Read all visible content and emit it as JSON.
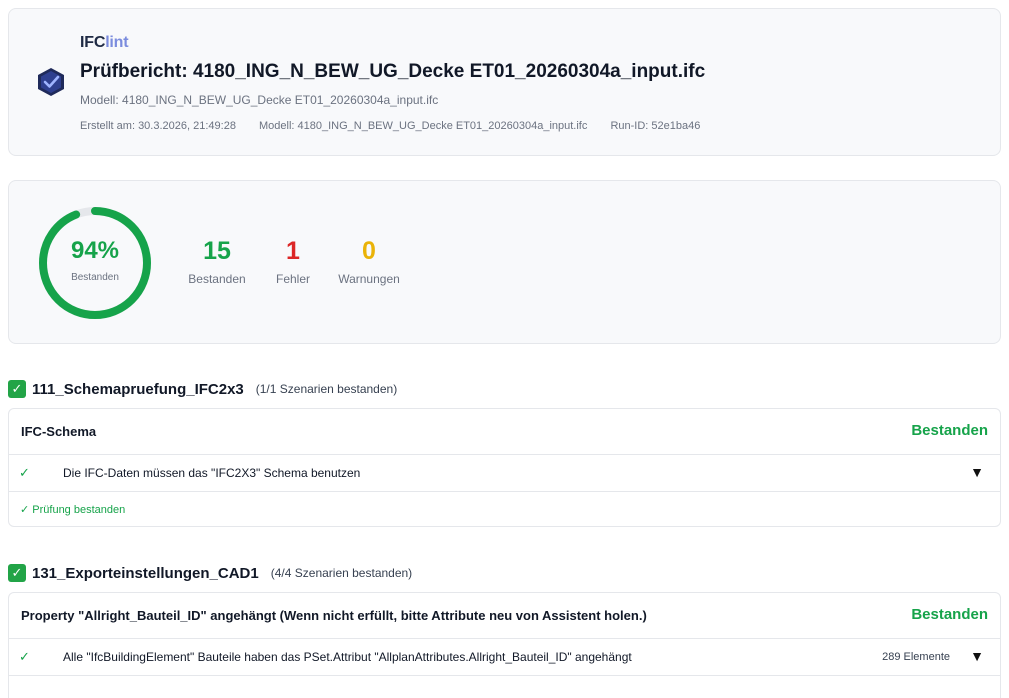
{
  "header": {
    "brand_prefix": "IFC",
    "brand_suffix": "lint",
    "title": "Prüfbericht: 4180_ING_N_BEW_UG_Decke ET01_20260304a_input.ifc",
    "model_line": "Modell: 4180_ING_N_BEW_UG_Decke ET01_20260304a_input.ifc",
    "created": "Erstellt am: 30.3.2026, 21:49:28",
    "model_meta": "Modell: 4180_ING_N_BEW_UG_Decke ET01_20260304a_input.ifc",
    "run_id": "Run-ID: 52e1ba46"
  },
  "summary": {
    "percent": "94%",
    "percent_value": 94,
    "percent_label": "Bestanden",
    "passed": "15",
    "passed_label": "Bestanden",
    "failed": "1",
    "failed_label": "Fehler",
    "warnings": "0",
    "warnings_label": "Warnungen"
  },
  "sections": [
    {
      "title": "111_Schemapruefung_IFC2x3",
      "count": "(1/1 Szenarien bestanden)",
      "group_title": "IFC-Schema",
      "status": "Bestanden",
      "rule_text": "Die IFC-Daten müssen das \"IFC2X3\" Schema benutzen",
      "rule_toggle": "▼",
      "pass_note": "✓ Prüfung bestanden"
    },
    {
      "title": "131_Exporteinstellungen_CAD1",
      "count": "(4/4 Szenarien bestanden)",
      "group_title": "Property \"Allright_Bauteil_ID\" angehängt (Wenn nicht erfüllt, bitte Attribute neu von Assistent holen.)",
      "status": "Bestanden",
      "rule_text": "Alle \"IfcBuildingElement\" Bauteile haben das PSet.Attribut \"AllplanAttributes.Allright_Bauteil_ID\" angehängt",
      "rule_count": "289 Elemente",
      "rule_toggle": "▼"
    }
  ],
  "icons": {
    "section_check": "white-check-mark-icon",
    "rule_check": "check-icon",
    "logo": "ifclint-shield-icon"
  },
  "colors": {
    "pass": "#16a34a",
    "fail": "#dc2626",
    "warn": "#eab308",
    "brand_accent": "#7b8cde"
  }
}
